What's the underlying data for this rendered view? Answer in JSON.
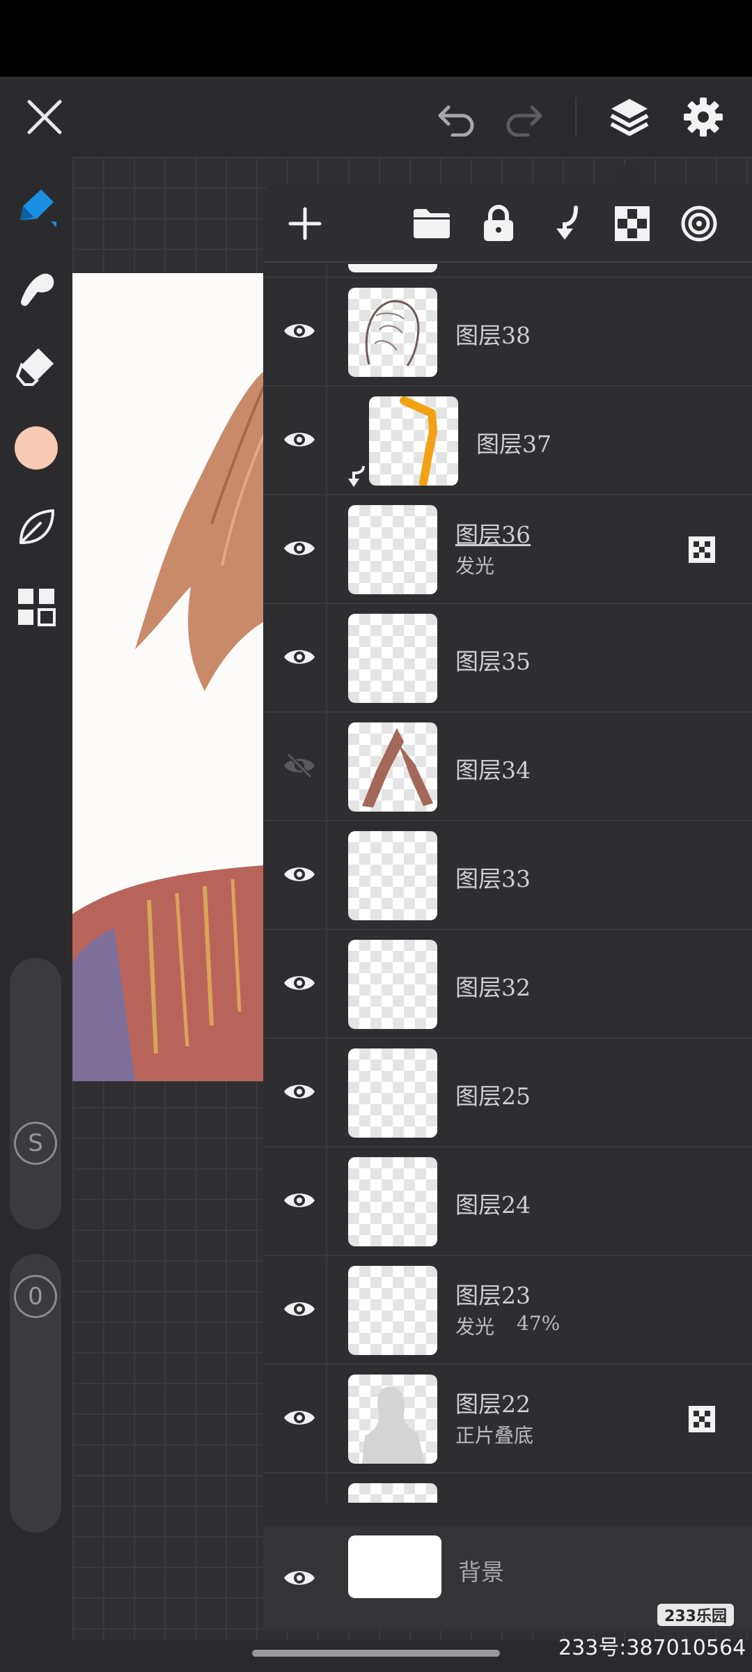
{
  "top_bar": {
    "icons": [
      "close-icon",
      "undo-icon",
      "redo-icon",
      "layers-icon",
      "settings-icon"
    ]
  },
  "left_toolbar": {
    "tools": [
      "pencil-icon",
      "smudge-icon",
      "eraser-icon",
      "color-swatch",
      "leaf-icon",
      "grid-icon"
    ],
    "brush_color": "#f8c9b3",
    "active_color": "#1a8fe3",
    "size_label": "S",
    "opacity_label": "0"
  },
  "layer_panel": {
    "toolbar_icons": [
      "add-icon",
      "folder-icon",
      "lock-icon",
      "merge-down-icon",
      "checker-icon",
      "target-icon"
    ],
    "layers": [
      {
        "name": "图层38",
        "blend": "",
        "visible": true
      },
      {
        "name": "图层37",
        "blend": "",
        "visible": true,
        "clipped": true
      },
      {
        "name": "图层36",
        "blend": "发光",
        "visible": true,
        "alpha_lock": true
      },
      {
        "name": "图层35",
        "blend": "",
        "visible": true
      },
      {
        "name": "图层34",
        "blend": "",
        "visible": false
      },
      {
        "name": "图层33",
        "blend": "",
        "visible": true
      },
      {
        "name": "图层32",
        "blend": "",
        "visible": true
      },
      {
        "name": "图层25",
        "blend": "",
        "visible": true
      },
      {
        "name": "图层24",
        "blend": "",
        "visible": true
      },
      {
        "name": "图层23",
        "blend": "发光",
        "opacity": "47%",
        "visible": true
      },
      {
        "name": "图层22",
        "blend": "正片叠底",
        "visible": true,
        "alpha_lock": true
      }
    ],
    "background": {
      "name": "背景",
      "visible": true
    }
  },
  "watermark": {
    "badge": "233乐园",
    "id": "233号:387010564"
  }
}
